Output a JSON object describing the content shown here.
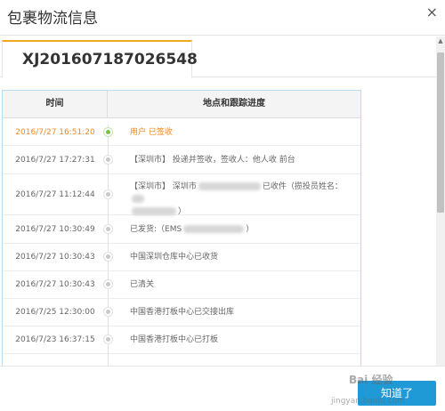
{
  "dialog": {
    "title": "包裹物流信息",
    "close_glyph": "×"
  },
  "tab": {
    "tracking_number": "XJ201607187026548"
  },
  "table": {
    "headers": {
      "time": "时间",
      "location": "地点和跟踪进度"
    },
    "rows": [
      {
        "time": "2016/7/27 16:51:20",
        "detail": "用户 已签收",
        "current": true
      },
      {
        "time": "2016/7/27 17:27:31",
        "detail": "【深圳市】 投递并签收，签收人：他人收 前台"
      },
      {
        "time": "2016/7/27 11:12:44",
        "detail_a": "【深圳市】 深圳市",
        "detail_b": "已收件（揽投员姓名：",
        "detail_c": "）"
      },
      {
        "time": "2016/7/27 10:30:49",
        "detail_a": "已发货:（EMS",
        "detail_b": "）"
      },
      {
        "time": "2016/7/27 10:30:43",
        "detail": "中国深圳仓库中心已收货"
      },
      {
        "time": "2016/7/27 10:30:43",
        "detail": "已清关"
      },
      {
        "time": "2016/7/25 12:30:00",
        "detail": "中国香港打板中心已交接出库"
      },
      {
        "time": "2016/7/23 16:37:15",
        "detail": "中国香港打板中心已打板"
      }
    ]
  },
  "footer": {
    "confirm_label": "知道了",
    "watermark_line1": "Bai 经验",
    "watermark_line2": "jingyan.baidu.com"
  },
  "colors": {
    "accent_tab": "#f5a623",
    "current_status": "#f08a24",
    "current_dot": "#7cc24a",
    "button": "#1f9ad6",
    "table_border": "#bcdcf2"
  }
}
